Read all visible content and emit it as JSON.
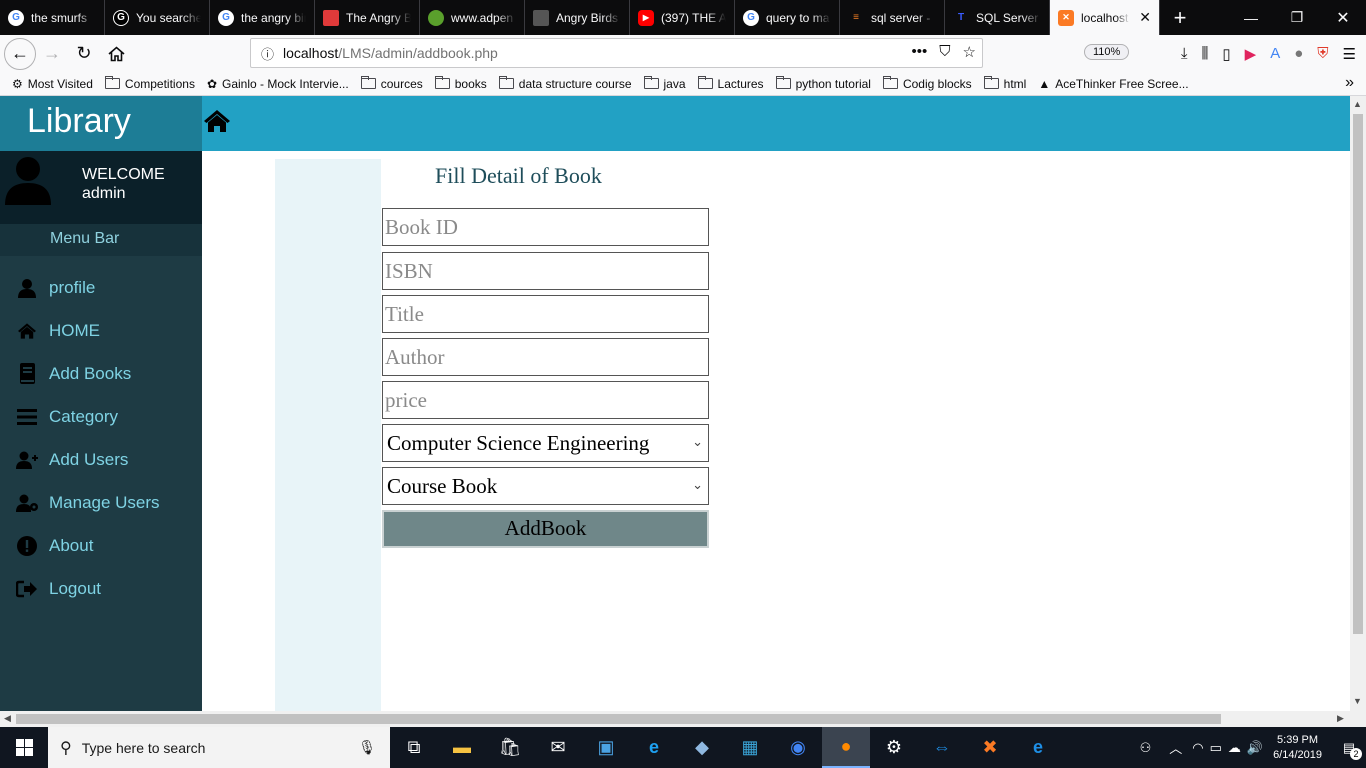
{
  "browser": {
    "tabs": [
      {
        "label": "the smurfs",
        "icon": "google-icon",
        "color": "#4285f4"
      },
      {
        "label": "You searched",
        "icon": "g-icon",
        "color": "#ffffff"
      },
      {
        "label": "the angry birds",
        "icon": "google-icon",
        "color": "#4285f4"
      },
      {
        "label": "The Angry Birds",
        "icon": "red-page-icon",
        "color": "#e03a3a"
      },
      {
        "label": "www.adpen",
        "icon": "bird-icon",
        "color": "#5aa02c"
      },
      {
        "label": "Angry Birds",
        "icon": "clapper-icon",
        "color": "#cccccc"
      },
      {
        "label": "(397) THE A",
        "icon": "youtube-icon",
        "color": "#ff0000"
      },
      {
        "label": "query to ma",
        "icon": "google-icon",
        "color": "#4285f4"
      },
      {
        "label": "sql server -",
        "icon": "stackoverflow-icon",
        "color": "#f48024"
      },
      {
        "label": "SQL Server",
        "icon": "t-icon",
        "color": "#1a3fd6"
      },
      {
        "label": "localhost",
        "icon": "xampp-icon",
        "color": "#fb7a24"
      }
    ],
    "url_host": "localhost",
    "url_path": "/LMS/admin/addbook.php",
    "zoom": "110%",
    "bookmarks": [
      "Most Visited",
      "Competitions",
      "Gainlo - Mock Intervie...",
      "cources",
      "books",
      "data structure course",
      "java",
      "Lactures",
      "python tutorial",
      "Codig blocks",
      "html",
      "AceThinker Free Scree..."
    ]
  },
  "app": {
    "brand": "Library",
    "welcome": "WELCOME",
    "username": "admin",
    "menu_bar": "Menu Bar",
    "menu": [
      {
        "label": "profile",
        "icon": "user-icon"
      },
      {
        "label": "HOME",
        "icon": "home-icon"
      },
      {
        "label": "Add Books",
        "icon": "book-icon"
      },
      {
        "label": "Category",
        "icon": "list-icon"
      },
      {
        "label": "Add Users",
        "icon": "user-plus-icon"
      },
      {
        "label": "Manage Users",
        "icon": "user-gear-icon"
      },
      {
        "label": "About",
        "icon": "info-icon"
      },
      {
        "label": "Logout",
        "icon": "logout-icon"
      }
    ]
  },
  "form": {
    "title": "Fill Detail of Book",
    "book_id_placeholder": "Book ID",
    "isbn_placeholder": "ISBN",
    "title_placeholder": "Title",
    "author_placeholder": "Author",
    "price_placeholder": "price",
    "category_selected": "Computer Science Engineering",
    "type_selected": "Course Book",
    "submit_label": "AddBook"
  },
  "taskbar": {
    "search_placeholder": "Type here to search",
    "time": "5:39 PM",
    "date": "6/14/2019",
    "notifications": "2"
  },
  "colors": {
    "topbar": "#22a1c4",
    "brand_bg": "#1d7d96",
    "sidebar": "#1e3b44",
    "menu_text": "#7fd3e4",
    "button": "#6f8789"
  }
}
